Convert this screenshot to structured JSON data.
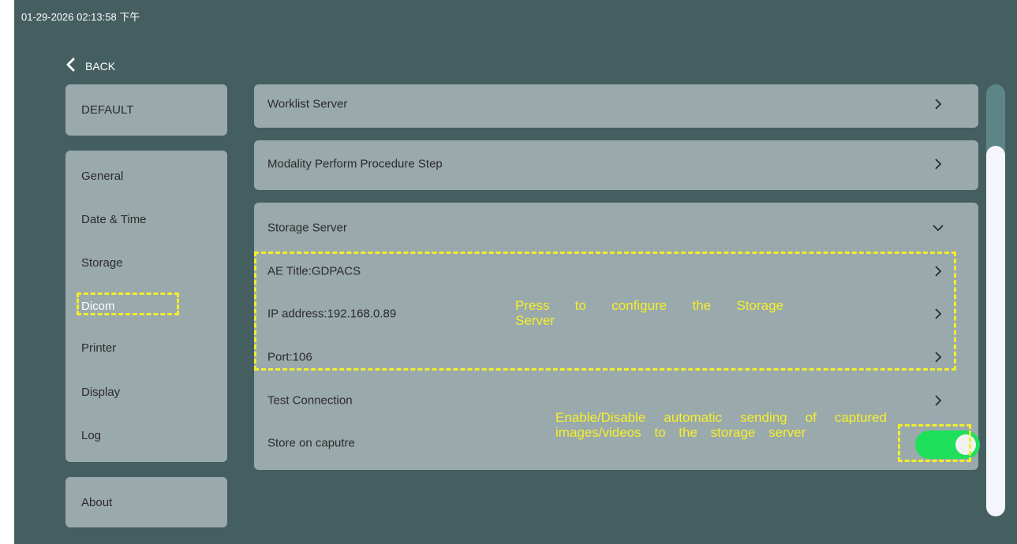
{
  "status_bar": {
    "datetime": "01-29-2026 02:13:58 下午"
  },
  "nav": {
    "back_label": "BACK"
  },
  "sidebar": {
    "profile": "DEFAULT",
    "items": [
      {
        "label": "General"
      },
      {
        "label": "Date & Time"
      },
      {
        "label": "Storage"
      },
      {
        "label": "Dicom"
      },
      {
        "label": "Printer"
      },
      {
        "label": "Display"
      },
      {
        "label": "Log"
      }
    ],
    "about": "About",
    "selected": "Dicom"
  },
  "main": {
    "worklist_server": "Worklist Server",
    "mpps": "Modality Perform Procedure Step",
    "storage_server": {
      "title": "Storage Server",
      "ae_title": "AE Title:GDPACS",
      "ip_address": "IP address:192.168.0.89",
      "port": "Port:106",
      "test_connection": "Test Connection",
      "store_on_capture": "Store on caputre",
      "store_on_capture_enabled": true
    }
  },
  "annotations": {
    "storage_config": "Press to configure the Storage Server",
    "auto_send": "Enable/Disable automatic sending of captured images/videos to the storage server"
  },
  "colors": {
    "background": "#455f61",
    "card": "#9aa9ac",
    "annotation": "#f5f02a",
    "toggle_on": "#1ee05a"
  }
}
